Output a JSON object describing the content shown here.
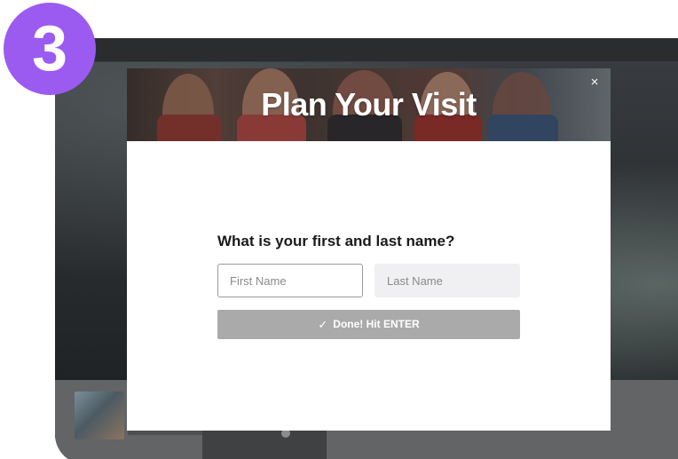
{
  "step_badge": {
    "number": "3",
    "color": "#9b5bf0"
  },
  "modal": {
    "title": "Plan Your Visit",
    "close_icon": "close-icon",
    "close_glyph": "×",
    "question": "What is your first and last name?",
    "first_name": {
      "placeholder": "First Name",
      "value": ""
    },
    "last_name": {
      "placeholder": "Last Name",
      "value": ""
    },
    "submit": {
      "icon": "check-icon",
      "icon_glyph": "✓",
      "label": "Done! Hit ENTER",
      "color": "#aaaaaa"
    }
  }
}
